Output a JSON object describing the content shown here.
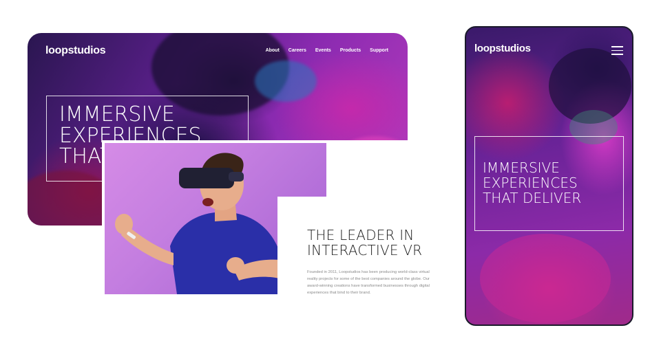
{
  "desktop": {
    "logo": "loopstudios",
    "nav": [
      "About",
      "Careers",
      "Events",
      "Products",
      "Support"
    ],
    "hero_lines": [
      "IMMERSIVE",
      "EXPERIENCES",
      "THAT DELIVER"
    ]
  },
  "content": {
    "title_lines": [
      "THE LEADER IN",
      "INTERACTIVE VR"
    ],
    "body": "Founded in 2011, Loopstudios has been producing world-class virtual reality projects for some of the best companies around the globe. Our award-winning creations have transformed businesses through digital experiences that bind to their brand.",
    "image_subject": "man-wearing-vr-headset"
  },
  "mobile": {
    "logo": "loopstudios",
    "menu_icon": "hamburger-menu-icon",
    "hero_lines": [
      "IMMERSIVE",
      "EXPERIENCES",
      "THAT DELIVER"
    ]
  },
  "colors": {
    "accent_purple": "#8a2ab0",
    "accent_magenta": "#c83dbf",
    "photo_bg": "#c47ee0",
    "text_dark": "#1c1c1c",
    "text_gray": "#8a8a8a"
  }
}
